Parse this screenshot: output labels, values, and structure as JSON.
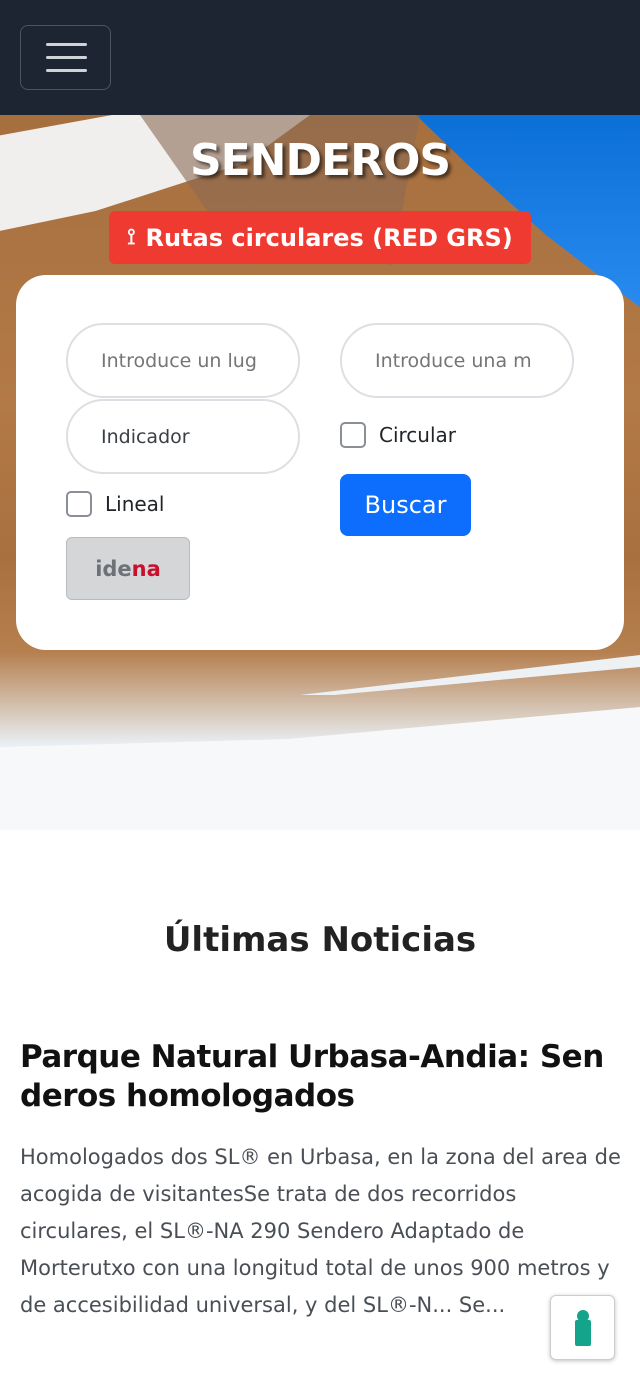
{
  "navbar": {
    "menu_icon": "hamburger-menu-icon"
  },
  "hero": {
    "title": "SENDEROS",
    "badge_icon": "route-icon",
    "badge_label": "Rutas circulares (RED GRS)"
  },
  "search": {
    "place_placeholder": "Introduce un lug",
    "matricula_placeholder": "Introduce una m",
    "indicator_value": "Indicador",
    "circular_label": "Circular",
    "lineal_label": "Lineal",
    "search_button": "Buscar",
    "idena_part1": "ide",
    "idena_part2": "na"
  },
  "news": {
    "section_title": "Últimas Noticias",
    "items": [
      {
        "title": "Parque Natural Urbasa-Andia: Sen deros homologados",
        "excerpt": "Homologados dos SL® en Urbasa, en la zona del area de acogida de visitantesSe trata de dos recorridos circulares, el SL®-NA 290 Sendero Adaptado de Morterutxo con una longitud total de unos 900 metros y de accesibilidad universal, y del SL®-N... Se..."
      }
    ]
  },
  "accessibility_button": {
    "icon": "keyhole-icon"
  },
  "colors": {
    "navbar": "#1c2531",
    "badge": "#ee3a31",
    "primary": "#0d6efd",
    "idena_red": "#c8102e"
  }
}
